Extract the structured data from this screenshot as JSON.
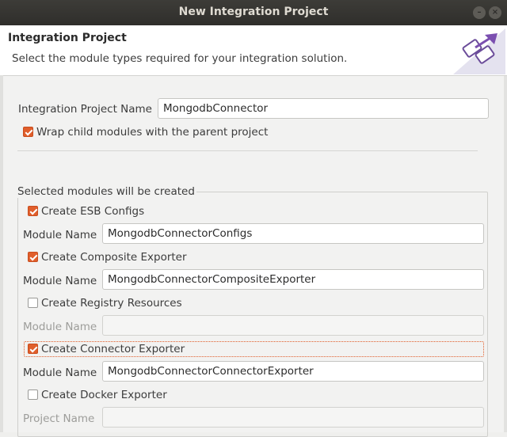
{
  "window": {
    "title": "New Integration Project"
  },
  "header": {
    "title": "Integration Project",
    "description": "Select the module types required for your integration solution."
  },
  "project": {
    "name_label": "Integration Project Name",
    "name_value": "MongodbConnector",
    "wrap_label": "Wrap child modules with the parent project",
    "wrap_checked": true
  },
  "modules": {
    "group_label": "Selected modules will be created",
    "esb": {
      "label": "Create ESB Configs",
      "checked": true,
      "field_label": "Module Name",
      "field_value": "MongodbConnectorConfigs"
    },
    "composite": {
      "label": "Create Composite Exporter",
      "checked": true,
      "field_label": "Module Name",
      "field_value": "MongodbConnectorCompositeExporter"
    },
    "registry": {
      "label": "Create Registry Resources",
      "checked": false,
      "field_label": "Module Name",
      "field_value": ""
    },
    "connector": {
      "label": "Create Connector Exporter",
      "checked": true,
      "field_label": "Module Name",
      "field_value": "MongodbConnectorConnectorExporter"
    },
    "docker": {
      "label": "Create Docker Exporter",
      "checked": false,
      "field_label": "Project Name",
      "field_value": ""
    }
  },
  "colors": {
    "accent": "#e05e2b",
    "titlebar": "#2f2e2b"
  }
}
